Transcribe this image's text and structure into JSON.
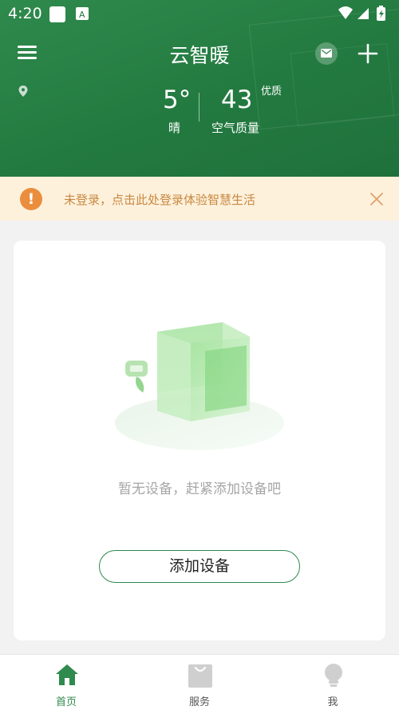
{
  "status_bar": {
    "time": "4:20"
  },
  "header": {
    "title": "云智暖",
    "weather": {
      "temperature": "5°",
      "condition": "晴"
    },
    "air_quality": {
      "value": "43",
      "level": "优质",
      "label": "空气质量"
    }
  },
  "login_banner": {
    "text": "未登录，点击此处登录体验智慧生活"
  },
  "empty_state": {
    "message": "暂无设备，赶紧添加设备吧",
    "add_button_label": "添加设备"
  },
  "bottom_nav": {
    "items": [
      {
        "label": "首页",
        "icon": "home-icon",
        "active": true
      },
      {
        "label": "服务",
        "icon": "shopping-bag-icon",
        "active": false
      },
      {
        "label": "我",
        "icon": "lightbulb-icon",
        "active": false
      }
    ]
  },
  "colors": {
    "primary": "#2f8a4d",
    "banner_bg": "#fdf1dc",
    "banner_text": "#c98840",
    "warning": "#ea8e3e"
  }
}
